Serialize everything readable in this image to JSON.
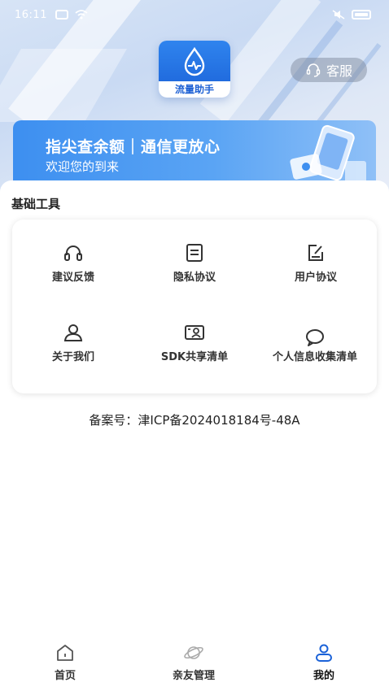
{
  "status_bar": {
    "time": "16:11"
  },
  "header": {
    "logo_text": "流量助手",
    "customer_service_label": "客服"
  },
  "banner": {
    "title": "指尖查余额｜通信更放心",
    "subtitle": "欢迎您的到来"
  },
  "tools": {
    "section_title": "基础工具",
    "items": [
      {
        "label": "建议反馈",
        "icon": "headset-icon"
      },
      {
        "label": "隐私协议",
        "icon": "document-icon"
      },
      {
        "label": "用户协议",
        "icon": "edit-document-icon"
      },
      {
        "label": "关于我们",
        "icon": "person-icon"
      },
      {
        "label": "SDK共享清单",
        "icon": "id-card-icon"
      },
      {
        "label": "个人信息收集清单",
        "icon": "chat-bubble-icon"
      }
    ]
  },
  "icp": "备案号：津ICP备2024018184号-48A",
  "bottom_nav": {
    "items": [
      {
        "label": "首页",
        "icon": "home-icon"
      },
      {
        "label": "亲友管理",
        "icon": "planet-icon"
      },
      {
        "label": "我的",
        "icon": "user-icon",
        "active": true
      }
    ]
  },
  "colors": {
    "primary_blue": "#1b62d8",
    "banner_blue": "#3d8ff0",
    "text_dark": "#222222"
  }
}
